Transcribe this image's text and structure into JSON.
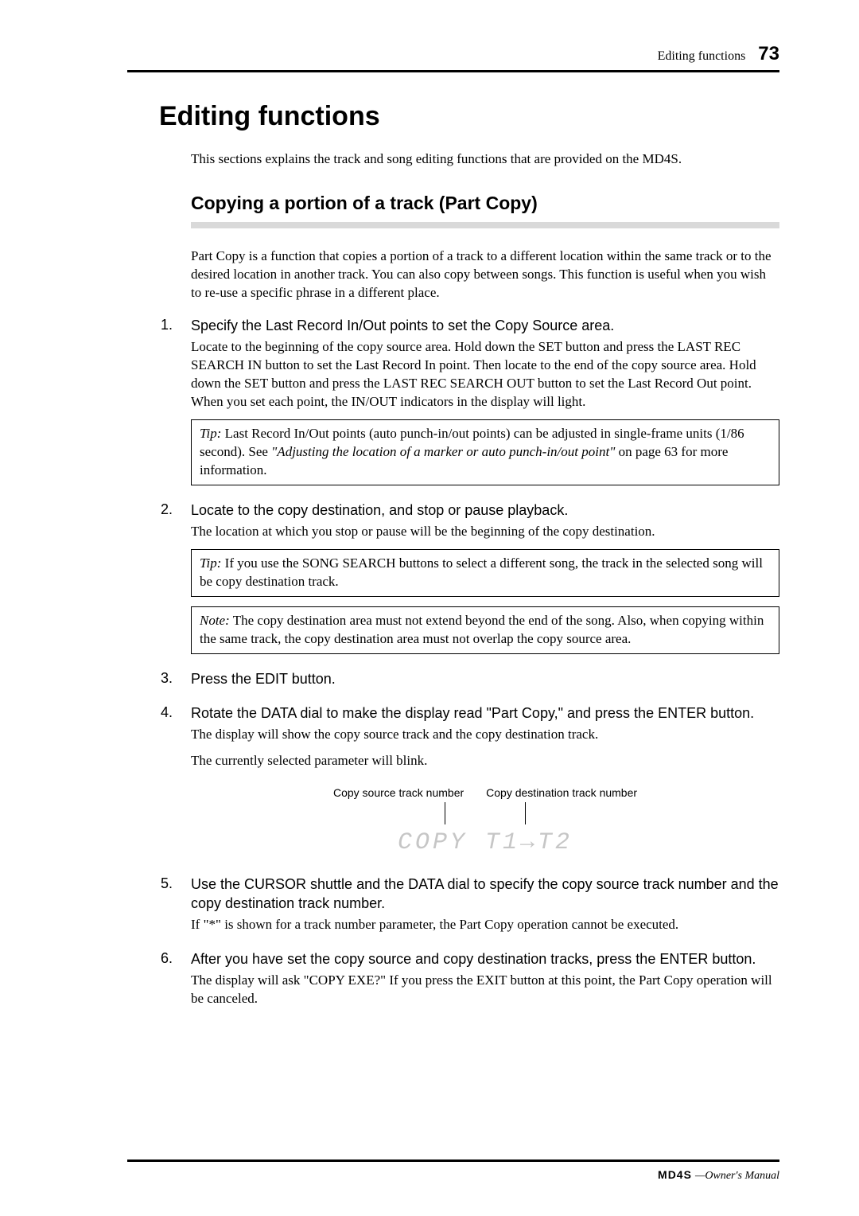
{
  "header": {
    "section_name": "Editing functions",
    "page_number": "73"
  },
  "title": "Editing functions",
  "intro": "This sections explains the track and song editing functions that are provided on the MD4S.",
  "subsection": {
    "title": "Copying a portion of a track (Part Copy)",
    "intro": "Part Copy is a function that copies a portion of a track to a different location within the same track or to the desired location in another track. You can also copy between songs. This function is useful when you wish to re-use a specific phrase in a different place."
  },
  "steps": [
    {
      "head": "Specify the Last Record In/Out points to set the Copy Source area.",
      "body": "Locate to the beginning of the copy source area. Hold down the SET button and press the LAST REC SEARCH IN button to set the Last Record In point. Then locate to the end of the copy source area. Hold down the SET button and press the LAST REC SEARCH OUT button to set the Last Record Out point. When you set each point, the IN/OUT indicators in the display will light.",
      "tip_label": "Tip:",
      "tip_text_pre": "  Last Record In/Out points (auto punch-in/out points) can be adjusted in single-frame units (1/86 second). See ",
      "tip_ref": "\"Adjusting the location of a marker or auto punch-in/out point\"",
      "tip_text_post": " on page 63 for more information."
    },
    {
      "head": "Locate to the copy destination, and stop or pause playback.",
      "body": "The location at which you stop or pause will be the beginning of the copy destination.",
      "tip_label": "Tip:",
      "tip_text": "  If you use the SONG SEARCH buttons to select a different song, the track in the selected song will be copy destination track.",
      "note_label": "Note:",
      "note_text": "  The copy destination area must not extend beyond the end of the song. Also, when copying within the same track, the copy destination area must not overlap the copy source area."
    },
    {
      "head": "Press the EDIT button."
    },
    {
      "head": "Rotate the DATA dial to make the display read \"Part Copy,\" and press the ENTER button.",
      "body1": "The display will show the copy source track and the copy destination track.",
      "body2": "The currently selected parameter will blink.",
      "diagram": {
        "left_label": "Copy source track number",
        "right_label": "Copy destination track number",
        "segment_text": "COPY T1→T2"
      }
    },
    {
      "head": "Use the CURSOR shuttle and the DATA dial to specify the copy source track number and the copy destination track number.",
      "body": "If \"*\" is shown for a track number parameter, the Part Copy operation cannot be executed."
    },
    {
      "head": "After you have set the copy source and copy destination tracks, press the ENTER button.",
      "body": "The display will ask \"COPY EXE?\" If you press the EXIT button at this point, the Part Copy operation will be canceled."
    }
  ],
  "footer": {
    "brand": "MD4S",
    "rest": "—Owner's Manual"
  }
}
